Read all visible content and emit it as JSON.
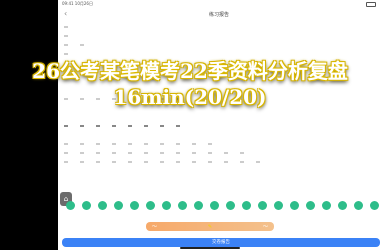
{
  "video_overlay": {
    "line1": "26公考某笔模考22季资料分析复盘",
    "line2": "16min(20/20)"
  },
  "status": {
    "time": "09:41 10月26日"
  },
  "nav": {
    "title": "练习报告",
    "back": "‹"
  },
  "side_tab": {
    "label": "⌂"
  },
  "answers": [
    "",
    "",
    "",
    "",
    "",
    "",
    "",
    "",
    "",
    "",
    "",
    "",
    "",
    "",
    "",
    "",
    "",
    "",
    "",
    "",
    ""
  ],
  "toolbar": {
    "left": "〜",
    "pencil": "✎"
  },
  "submit": {
    "label": "交卷报告"
  },
  "colors": {
    "correct": "#2ebd8a",
    "submit": "#3b82f6",
    "title_outline": "#d4b000"
  }
}
